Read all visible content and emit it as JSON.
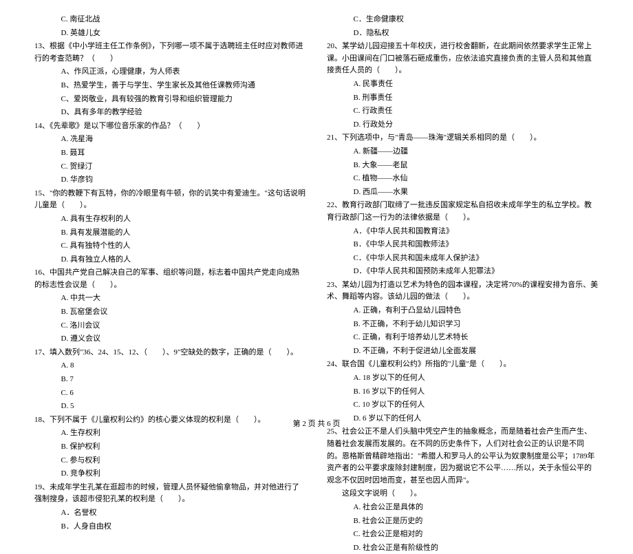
{
  "left": {
    "q12_options": [
      "C. 南征北战",
      "D. 英雄儿女"
    ],
    "q13": "13、根据《中小学班主任工作条例》，下列哪一项不属于选聘班主任时应对教师进行的考查范畴？（　　）",
    "q13_options": [
      "A、作风正派，心理健康，为人师表",
      "B、热爱学生，善于与学生、学生家长及其他任课教师沟通",
      "C、爱岗敬业，具有较强的教育引导和组织管理能力",
      "D、具有多年的教学经验"
    ],
    "q14": "14、《先辈歌》是以下哪位音乐家的作品？（　　）",
    "q14_options": [
      "A. 冼星海",
      "B. 聂耳",
      "C. 贺绿汀",
      "D. 华彦钧"
    ],
    "q15": "15、\"你的教鞭下有瓦特，你的冷眼里有牛顿，你的讥笑中有爱迪生。\"这句话说明儿童是（　　）。",
    "q15_options": [
      "A. 具有生存权利的人",
      "B. 具有发展潜能的人",
      "C. 具有独特个性的人",
      "D. 具有独立人格的人"
    ],
    "q16": "16、中国共产党自己解决自己的军事、组织等问题，标志着中国共产党走向成熟的标志性会议是（　　）。",
    "q16_options": [
      "A. 中共一大",
      "B. 瓦窑堡会议",
      "C. 洛川会议",
      "D. 遵义会议"
    ],
    "q17": "17、填入数列\"36、24、15、12、（　　）、9\"空缺处的数字，正确的是（　　）。",
    "q17_options": [
      "A. 8",
      "B. 7",
      "C. 6",
      "D. 5"
    ],
    "q18": "18、下列不属于《儿童权利公约》的核心要义体现的权利是（　　）。",
    "q18_options": [
      "A. 生存权利",
      "B. 保护权利",
      "C. 参与权利",
      "D. 竞争权利"
    ],
    "q19": "19、未成年学生孔某在逛超市的时候，管理人员怀疑他偷拿物品，并对他进行了强制搜身，该超市侵犯孔某的权利是（　　）。",
    "q19_options": [
      "A．名誉权",
      "B．人身自由权"
    ]
  },
  "right": {
    "q19_options_cont": [
      "C．生命健康权",
      "D．隐私权"
    ],
    "q20": "20、某学幼儿园迎接五十年校庆，进行校舍翻新，在此期间依然要求学生正常上课。小田课间在门口被落石砸成重伤，应依法追究直接负责的主管人员和其他直接责任人员的（　　）。",
    "q20_options": [
      "A. 民事责任",
      "B. 刑事责任",
      "C. 行政责任",
      "D. 行政处分"
    ],
    "q21": "21、下列选项中，与\"青岛——珠海\"逻辑关系相同的是（　　）。",
    "q21_options": [
      "A. 新疆——边疆",
      "B. 大象——老鼠",
      "C. 植物——水仙",
      "D. 西瓜——水果"
    ],
    "q22": "22、教育行政部门取缔了一批违反国家规定私自招收未成年学生的私立学校。教育行政部门这一行为的法律依据是（　　）。",
    "q22_options": [
      "A．《中华人民共和国教育法》",
      "B．《中华人民共和国教师法》",
      "C．《中华人民共和国未成年人保护法》",
      "D．《中华人民共和国预防未成年人犯罪法》"
    ],
    "q23": "23、某幼儿园为打造以艺术为特色的园本课程，决定将70%的课程安排为音乐、美术、舞蹈等内容。该幼儿园的做法（　　）。",
    "q23_options": [
      "A. 正确，有利于凸显幼儿园特色",
      "B. 不正确，不利于幼儿知识学习",
      "C. 正确，有利于培养幼儿艺术特长",
      "D. 不正确，不利于促进幼儿全面发展"
    ],
    "q24": "24、联合国《儿童权利公约》所指的\"儿童\"是（　　）。",
    "q24_options": [
      "A. 18 岁以下的任何人",
      "B. 16 岁以下的任何人",
      "C. 10 岁以下的任何人",
      "D. 6 岁以下的任何人"
    ],
    "q25": "25、社会公正不是人们头脑中凭空产生的抽象概念，而是随着社会产生而产生、随着社会发展而发展的。在不同的历史条件下，人们对社会公正的认识是不同的。恩格斯曾精辟地指出：\"希腊人和罗马人的公平认为奴隶制度是公平；1789年资产者的公平要求废除封建制度，因为据说它不公平……所以，关于永恒公平的观念不仅因时因地而变，甚至也因人而异\"。",
    "q25_cont": "这段文字说明（　　）。",
    "q25_options": [
      "A. 社会公正是具体的",
      "B. 社会公正是历史的",
      "C. 社会公正是相对的",
      "D. 社会公正是有阶级性的"
    ]
  },
  "footer": "第 2 页 共 6 页"
}
